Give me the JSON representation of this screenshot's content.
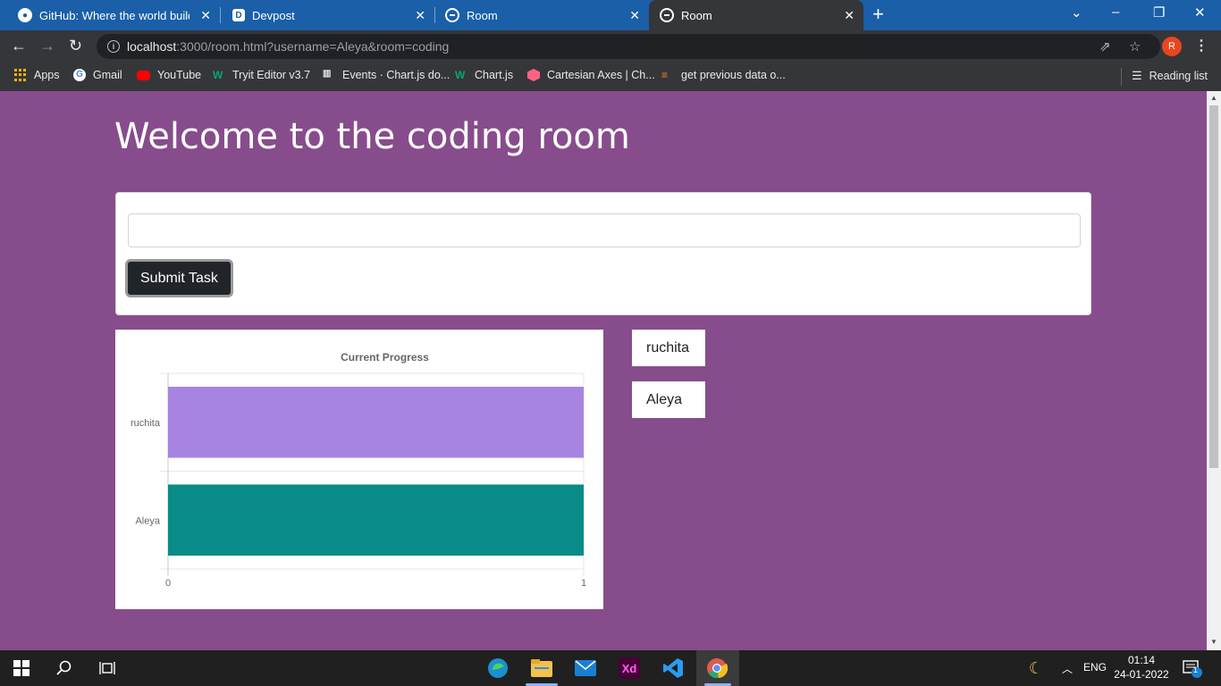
{
  "browser": {
    "tabs": [
      {
        "title": "GitHub: Where the world builds s",
        "icon": "github-icon"
      },
      {
        "title": "Devpost",
        "icon": "devpost-icon"
      },
      {
        "title": "Room",
        "icon": "globe-icon"
      },
      {
        "title": "Room",
        "icon": "globe-icon",
        "active": true
      }
    ],
    "url_host": "localhost",
    "url_rest": ":3000/room.html?username=Aleya&room=coding",
    "profile_initial": "R",
    "bookmarks": [
      {
        "label": "Apps",
        "icon": "apps-grid-icon"
      },
      {
        "label": "Gmail",
        "icon": "google-icon"
      },
      {
        "label": "YouTube",
        "icon": "youtube-icon"
      },
      {
        "label": "Tryit Editor v3.7",
        "icon": "w3schools-icon"
      },
      {
        "label": "Events · Chart.js do...",
        "icon": "chartjs-docs-icon"
      },
      {
        "label": "Chart.js",
        "icon": "w3schools-icon"
      },
      {
        "label": "Cartesian Axes | Ch...",
        "icon": "chartjs-icon"
      },
      {
        "label": "get previous data o...",
        "icon": "stackoverflow-icon"
      }
    ],
    "reading_list": "Reading list"
  },
  "page": {
    "title": "Welcome to the coding room",
    "task_input_value": "",
    "submit_label": "Submit Task",
    "users": [
      "ruchita",
      "Aleya"
    ]
  },
  "chart_data": {
    "type": "bar",
    "orientation": "horizontal",
    "title": "Current Progress",
    "categories": [
      "ruchita",
      "Aleya"
    ],
    "values": [
      1,
      1
    ],
    "colors": [
      "#a784e2",
      "#098b87"
    ],
    "xlim": [
      0,
      1
    ],
    "xticks": [
      "0",
      "1"
    ],
    "xlabel": "",
    "ylabel": "",
    "grid": true
  },
  "taskbar": {
    "language": "ENG",
    "time": "01:14",
    "date": "24-01-2022",
    "notification_count": "1"
  }
}
